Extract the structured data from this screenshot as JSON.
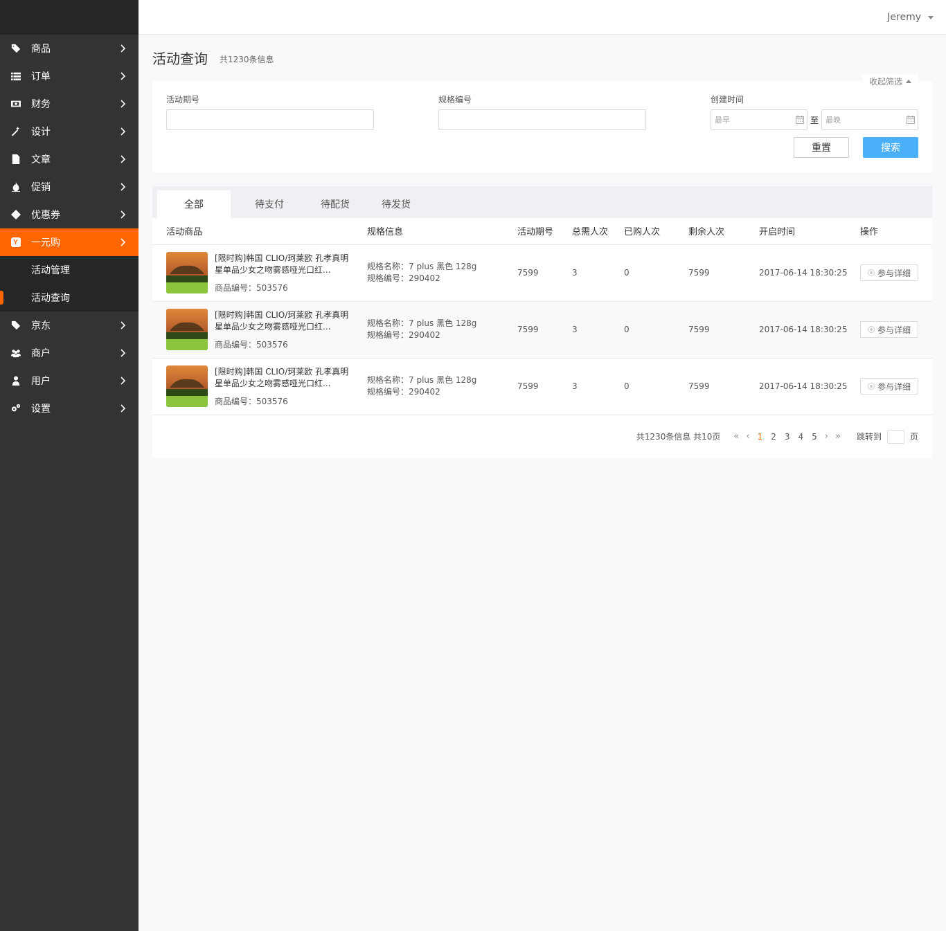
{
  "header": {
    "user": "Jeremy"
  },
  "sidebar": {
    "items": [
      {
        "label": "商品",
        "icon": "tag-icon"
      },
      {
        "label": "订单",
        "icon": "list-icon"
      },
      {
        "label": "财务",
        "icon": "money-icon"
      },
      {
        "label": "设计",
        "icon": "magic-wand-icon"
      },
      {
        "label": "文章",
        "icon": "file-icon"
      },
      {
        "label": "促销",
        "icon": "fire-icon"
      },
      {
        "label": "优惠券",
        "icon": "ticket-icon"
      },
      {
        "label": "一元购",
        "icon": "y-badge-icon",
        "badge": "Y"
      },
      {
        "label": "京东",
        "icon": "tag-icon"
      },
      {
        "label": "商户",
        "icon": "users-icon"
      },
      {
        "label": "用户",
        "icon": "user-icon"
      },
      {
        "label": "设置",
        "icon": "gears-icon"
      }
    ],
    "sub": [
      {
        "label": "活动管理"
      },
      {
        "label": "活动查询"
      }
    ]
  },
  "page": {
    "title": "活动查询",
    "count": "共1230条信息"
  },
  "filter": {
    "collapse": "收起筛选",
    "activity_no_label": "活动期号",
    "spec_no_label": "规格编号",
    "created_label": "创建时间",
    "date_from": "最早",
    "date_to": "最晚",
    "to_sep": "至",
    "reset": "重置",
    "search": "搜索"
  },
  "tabs": [
    "全部",
    "待支付",
    "待配货",
    "待发货"
  ],
  "table": {
    "headers": [
      "活动商品",
      "规格信息",
      "活动期号",
      "总需人次",
      "已购人次",
      "剩余人次",
      "开启时间",
      "操作"
    ],
    "rows": [
      {
        "name": "[限时购]韩国 CLIO/珂莱欧 孔孝真明星单品少女之吻雾感哑光口红...",
        "code": "商品编号：503576",
        "spec_name": "规格名称：7 plus 黑色 128g",
        "spec_no": "规格编号：290402",
        "period": "7599",
        "total": "3",
        "bought": "0",
        "remain": "7599",
        "time": "2017-06-14 18:30:25",
        "action": "参与详细"
      },
      {
        "name": "[限时购]韩国 CLIO/珂莱欧 孔孝真明星单品少女之吻雾感哑光口红...",
        "code": "商品编号：503576",
        "spec_name": "规格名称：7 plus 黑色 128g",
        "spec_no": "规格编号：290402",
        "period": "7599",
        "total": "3",
        "bought": "0",
        "remain": "7599",
        "time": "2017-06-14 18:30:25",
        "action": "参与详细"
      },
      {
        "name": "[限时购]韩国 CLIO/珂莱欧 孔孝真明星单品少女之吻雾感哑光口红...",
        "code": "商品编号：503576",
        "spec_name": "规格名称：7 plus 黑色 128g",
        "spec_no": "规格编号：290402",
        "period": "7599",
        "total": "3",
        "bought": "0",
        "remain": "7599",
        "time": "2017-06-14 18:30:25",
        "action": "参与详细"
      }
    ]
  },
  "pager": {
    "info": "共1230条信息 共10页",
    "pages": [
      "1",
      "2",
      "3",
      "4",
      "5"
    ],
    "current": "1",
    "jump_label": "跳转到",
    "jump_unit": "页"
  },
  "colors": {
    "accent": "#ff6600",
    "primary": "#4aaef9",
    "sidebar": "#333333"
  }
}
